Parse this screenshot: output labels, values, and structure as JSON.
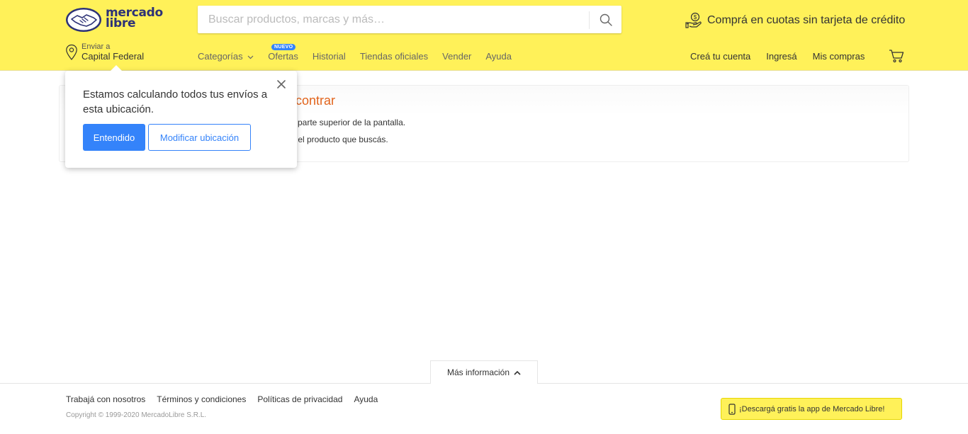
{
  "header": {
    "logo_text": "mercado\nlibre",
    "search_placeholder": "Buscar productos, marcas y más…",
    "promo_text": "Comprá en cuotas sin tarjeta de crédito",
    "location_label": "Enviar a",
    "location_value": "Capital Federal",
    "nav": {
      "categorias": "Categorías",
      "ofertas": "Ofertas",
      "ofertas_badge": "NUEVO",
      "historial": "Historial",
      "tiendas": "Tiendas oficiales",
      "vender": "Vender",
      "ayuda": "Ayuda"
    },
    "account": {
      "crea": "Creá tu cuenta",
      "ingresa": "Ingresá",
      "compras": "Mis compras"
    }
  },
  "card": {
    "title": "contrar",
    "line1": "parte superior de la pantalla.",
    "line2": "r el producto que buscás."
  },
  "popover": {
    "message": "Estamos calculando todos tus envíos a esta ubicación.",
    "primary_label": "Entendido",
    "secondary_label": "Modificar ubicación"
  },
  "footer": {
    "more_label": "Más información",
    "links": {
      "trabaja": "Trabajá con nosotros",
      "terminos": "Términos y condiciones",
      "politicas": "Políticas de privacidad",
      "ayuda": "Ayuda"
    },
    "copyright": "Copyright © 1999-2020 MercadoLibre S.R.L.",
    "app_label": "¡Descargá gratis la app de Mercado Libre!"
  },
  "colors": {
    "brand_yellow": "#fff159",
    "brand_blue": "#3483fa",
    "logo_navy": "#2d3277",
    "title_orange": "#e2641c"
  },
  "icons": [
    "handshake-logo-icon",
    "search-icon",
    "money-hand-icon",
    "location-pin-icon",
    "chevron-down-icon",
    "cart-icon",
    "close-icon",
    "chevron-up-icon",
    "phone-icon"
  ]
}
